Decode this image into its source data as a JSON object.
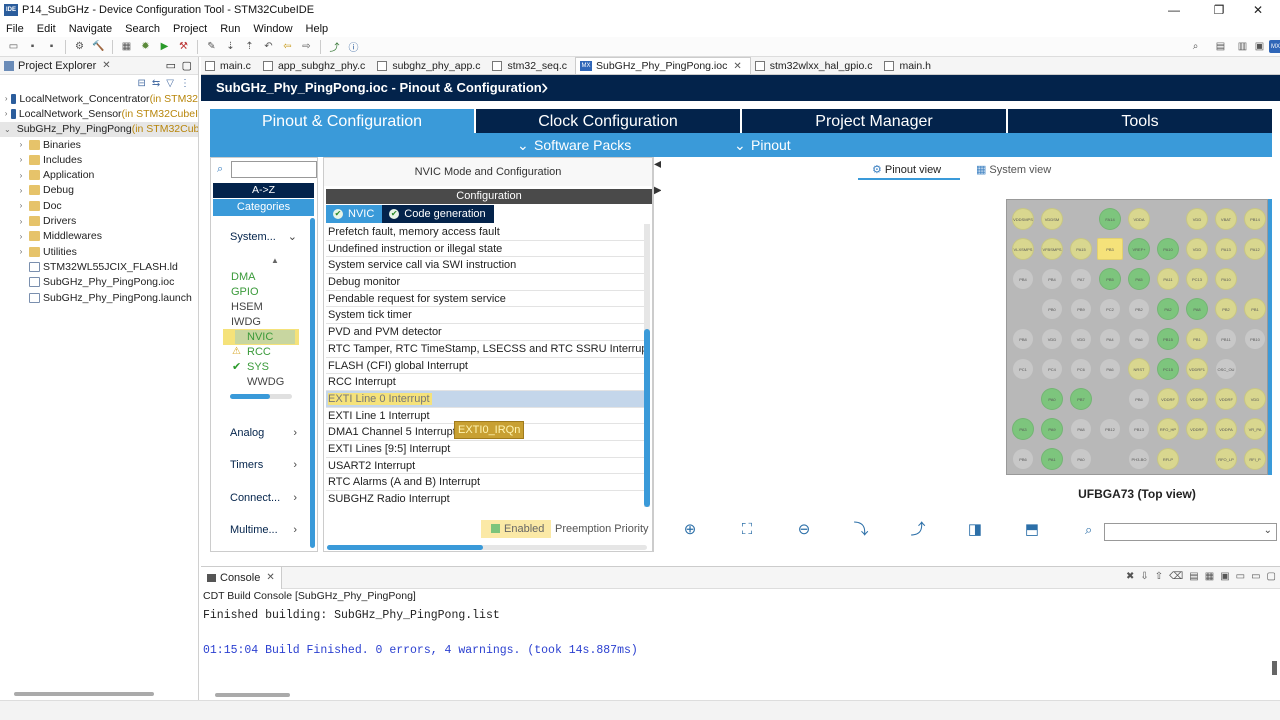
{
  "window": {
    "title": "P14_SubGHz - Device Configuration Tool - STM32CubeIDE"
  },
  "menu": [
    "File",
    "Edit",
    "Navigate",
    "Search",
    "Project",
    "Run",
    "Window",
    "Help"
  ],
  "project_explorer": {
    "label": "Project Explorer",
    "items": [
      {
        "name": "LocalNetwork_Concentrator",
        "dec": " (in STM32",
        "type": "project",
        "expanded": false
      },
      {
        "name": "LocalNetwork_Sensor",
        "dec": " (in STM32CubeI",
        "type": "project",
        "expanded": false
      },
      {
        "name": "SubGHz_Phy_PingPong",
        "dec": " (in STM32Cube",
        "type": "project",
        "expanded": true
      },
      {
        "name": "Binaries",
        "dec": "",
        "type": "folder"
      },
      {
        "name": "Includes",
        "dec": "",
        "type": "folder"
      },
      {
        "name": "Application",
        "dec": "",
        "type": "folder"
      },
      {
        "name": "Debug",
        "dec": "",
        "type": "folder"
      },
      {
        "name": "Doc",
        "dec": "",
        "type": "folder"
      },
      {
        "name": "Drivers",
        "dec": "",
        "type": "folder"
      },
      {
        "name": "Middlewares",
        "dec": "",
        "type": "folder"
      },
      {
        "name": "Utilities",
        "dec": "",
        "type": "folder"
      },
      {
        "name": "STM32WL55JCIX_FLASH.ld",
        "dec": "",
        "type": "file"
      },
      {
        "name": "SubGHz_Phy_PingPong.ioc",
        "dec": "",
        "type": "file"
      },
      {
        "name": "SubGHz_Phy_PingPong.launch",
        "dec": "",
        "type": "file"
      }
    ]
  },
  "editor_tabs": [
    {
      "label": "main.c"
    },
    {
      "label": "app_subghz_phy.c"
    },
    {
      "label": "subghz_phy_app.c"
    },
    {
      "label": "stm32_seq.c"
    },
    {
      "label": "SubGHz_Phy_PingPong.ioc",
      "active": true
    },
    {
      "label": "stm32wlxx_hal_gpio.c"
    },
    {
      "label": "main.h"
    }
  ],
  "cube": {
    "breadcrumb": "SubGHz_Phy_PingPong.ioc - Pinout & Configuration",
    "tabs": [
      "Pinout & Configuration",
      "Clock Configuration",
      "Project Manager",
      "Tools"
    ],
    "subtabs": [
      "Software Packs",
      "Pinout"
    ]
  },
  "categories": {
    "sort": "A->Z",
    "title": "Categories",
    "groups": [
      "System...",
      "Analog",
      "Timers",
      "Connect...",
      "Multime..."
    ],
    "system_items": [
      "DMA",
      "GPIO",
      "HSEM",
      "IWDG",
      "NVIC",
      "RCC",
      "SYS",
      "WWDG"
    ]
  },
  "config": {
    "mode_title": "NVIC Mode and Configuration",
    "header": "Configuration",
    "tabs": [
      "NVIC",
      "Code generation"
    ],
    "interrupts": [
      "Prefetch fault, memory access fault",
      "Undefined instruction or illegal state",
      "System service call via SWI instruction",
      "Debug monitor",
      "Pendable request for system service",
      "System tick timer",
      "PVD and PVM detector",
      "RTC Tamper, RTC TimeStamp, LSECSS and RTC SSRU Interrupts",
      "FLASH (CFI)  global Interrupt",
      "RCC Interrupt",
      "EXTI Line 0 Interrupt",
      "EXTI Line 1 Interrupt",
      "DMA1 Channel 5 Interrupt",
      "EXTI Lines [9:5] Interrupt",
      "USART2 Interrupt",
      "RTC Alarms (A and B) Interrupt",
      "SUBGHZ Radio Interrupt"
    ],
    "tooltip": "EXTI0_IRQn",
    "enabled_label": "Enabled",
    "priority_label": "Preemption Priority"
  },
  "pinout": {
    "views": [
      "Pinout view",
      "System view"
    ],
    "package": "UFBGA73 (Top view)",
    "colors": {
      "green": "#7dc57d",
      "yellow": "#d9d78f",
      "gray": "#c8c8c8",
      "highlight": "#f5e27a"
    },
    "pins": [
      [
        "VDDSMPS",
        "VDDSM",
        "",
        "FA14",
        "VDDA",
        "",
        "VDD",
        "VBAT",
        "PB14"
      ],
      [
        "VLXSMPS",
        "VFBSMPS",
        "PA15",
        "PB3",
        "VREF+",
        "PA10",
        "VDD",
        "PA13",
        "PA12"
      ],
      [
        "PB4",
        "PB4",
        "PA7",
        "PB5",
        "PA5",
        "PA11",
        "PC13",
        "PA10",
        ""
      ],
      [
        "",
        "PB0",
        "PB9",
        "PC2",
        "PB2",
        "PA2",
        "PA8",
        "PB2",
        "PB1"
      ],
      [
        "PB8",
        "VDD",
        "VDD",
        "PA4",
        "PA6",
        "PB15",
        "PB1",
        "PB11",
        "PB10"
      ],
      [
        "PC1",
        "PC4",
        "PC6",
        "PA6",
        "NRST",
        "PC15",
        "VDDRF1",
        "OSC_OU",
        ""
      ],
      [
        "",
        "PA0",
        "PB7",
        "",
        "PB6",
        "VDDRF",
        "VDDRF",
        "VDDRF",
        "VDD"
      ],
      [
        "PA3",
        "PA9",
        "PA8",
        "PB12",
        "PB13",
        "RFO_HP",
        "VDDRF",
        "VDDPA",
        "VR_PA"
      ],
      [
        "PB6",
        "PA1",
        "PA0",
        "",
        "PH3-BO",
        "RFLP",
        "",
        "RFO_LP",
        "RFI_P"
      ]
    ],
    "pin_states": [
      [
        "y",
        "y",
        "",
        "g",
        "y",
        "",
        "y",
        "y",
        "y"
      ],
      [
        "y",
        "y",
        "y",
        "h",
        "g",
        "g",
        "y",
        "y",
        "y"
      ],
      [
        "gr",
        "gr",
        "gr",
        "g",
        "g",
        "y",
        "y",
        "y",
        ""
      ],
      [
        "",
        "gr",
        "gr",
        "gr",
        "gr",
        "g",
        "g",
        "y",
        "y"
      ],
      [
        "gr",
        "gr",
        "gr",
        "gr",
        "gr",
        "g",
        "y",
        "gr",
        "gr"
      ],
      [
        "gr",
        "gr",
        "gr",
        "gr",
        "y",
        "g",
        "y",
        "gr",
        ""
      ],
      [
        "",
        "g",
        "g",
        "",
        "gr",
        "y",
        "y",
        "y",
        "y"
      ],
      [
        "g",
        "g",
        "gr",
        "gr",
        "gr",
        "y",
        "y",
        "y",
        "y"
      ],
      [
        "gr",
        "g",
        "gr",
        "",
        "gr",
        "y",
        "",
        "y",
        "y"
      ]
    ]
  },
  "console": {
    "tab": "Console",
    "subtitle": "CDT Build Console [SubGHz_Phy_PingPong]",
    "line1": "Finished building: SubGHz_Phy_PingPong.list",
    "line2": "01:15:04 Build Finished. 0 errors, 4 warnings. (took 14s.887ms)"
  }
}
